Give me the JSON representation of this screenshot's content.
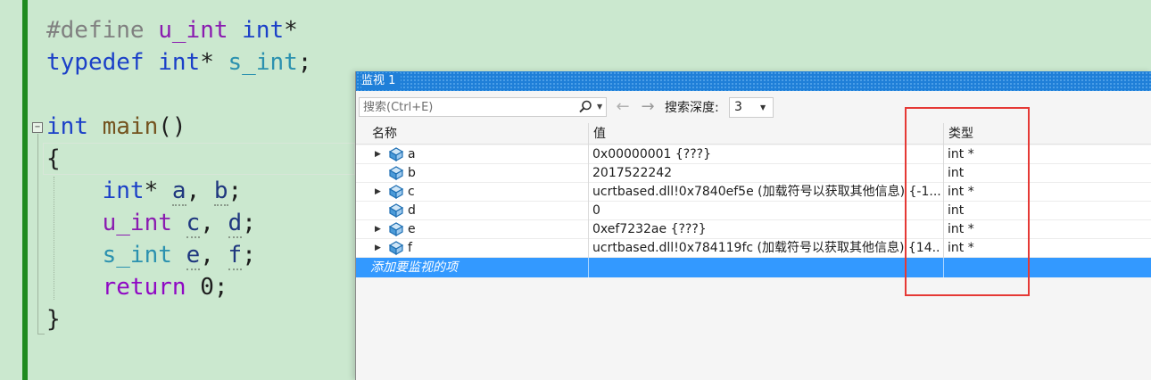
{
  "editor": {
    "lines": [
      {
        "id": "define",
        "parts": [
          {
            "t": "#define ",
            "c": "pre"
          },
          {
            "t": "u_int",
            "c": "macro"
          },
          {
            "t": " ",
            "c": ""
          },
          {
            "t": "int",
            "c": "kw-blue"
          },
          {
            "t": "*",
            "c": ""
          }
        ]
      },
      {
        "id": "typedef",
        "parts": [
          {
            "t": "typedef",
            "c": "kw-blue"
          },
          {
            "t": " ",
            "c": ""
          },
          {
            "t": "int",
            "c": "kw-blue"
          },
          {
            "t": "* ",
            "c": ""
          },
          {
            "t": "s_int",
            "c": "type"
          },
          {
            "t": ";",
            "c": ""
          }
        ]
      },
      {
        "id": "main-sig",
        "parts": [
          {
            "t": "int",
            "c": "kw-blue"
          },
          {
            "t": " ",
            "c": ""
          },
          {
            "t": "main",
            "c": "fn"
          },
          {
            "t": "()",
            "c": ""
          }
        ]
      },
      {
        "id": "brace-open",
        "parts": [
          {
            "t": "{",
            "c": ""
          }
        ]
      },
      {
        "id": "decl-ab",
        "parts": [
          {
            "t": "    ",
            "c": ""
          },
          {
            "t": "int",
            "c": "kw-blue"
          },
          {
            "t": "* ",
            "c": ""
          },
          {
            "t": "a",
            "c": "var dotted"
          },
          {
            "t": ", ",
            "c": ""
          },
          {
            "t": "b",
            "c": "var dotted"
          },
          {
            "t": ";",
            "c": ""
          }
        ]
      },
      {
        "id": "decl-cd",
        "parts": [
          {
            "t": "    ",
            "c": ""
          },
          {
            "t": "u_int",
            "c": "macro"
          },
          {
            "t": " ",
            "c": ""
          },
          {
            "t": "c",
            "c": "var dotted"
          },
          {
            "t": ", ",
            "c": ""
          },
          {
            "t": "d",
            "c": "var dotted"
          },
          {
            "t": ";",
            "c": ""
          }
        ]
      },
      {
        "id": "decl-ef",
        "parts": [
          {
            "t": "    ",
            "c": ""
          },
          {
            "t": "s_int",
            "c": "type"
          },
          {
            "t": " ",
            "c": ""
          },
          {
            "t": "e",
            "c": "var dotted"
          },
          {
            "t": ", ",
            "c": ""
          },
          {
            "t": "f",
            "c": "var dotted"
          },
          {
            "t": ";",
            "c": ""
          }
        ]
      },
      {
        "id": "return",
        "parts": [
          {
            "t": "    ",
            "c": ""
          },
          {
            "t": "return",
            "c": "kw-purple"
          },
          {
            "t": " 0;",
            "c": "num"
          }
        ]
      },
      {
        "id": "brace-close",
        "parts": [
          {
            "t": "}",
            "c": ""
          }
        ]
      }
    ],
    "collapse_glyph": "−"
  },
  "watch": {
    "title": "监视 1",
    "search_placeholder": "搜索(Ctrl+E)",
    "search_dropdown_glyph": "▼",
    "back_glyph": "←",
    "forward_glyph": "→",
    "depth_label": "搜索深度:",
    "depth_value": "3",
    "depth_arrow_glyph": "▼",
    "columns": {
      "name": "名称",
      "value": "值",
      "type": "类型"
    },
    "rows": [
      {
        "expandable": true,
        "name": "a",
        "value": "0x00000001 {???}",
        "type": "int *"
      },
      {
        "expandable": false,
        "name": "b",
        "value": "2017522242",
        "type": "int"
      },
      {
        "expandable": true,
        "name": "c",
        "value": "ucrtbased.dll!0x7840ef5e (加载符号以获取其他信息) {-1...",
        "type": "int *"
      },
      {
        "expandable": false,
        "name": "d",
        "value": "0",
        "type": "int"
      },
      {
        "expandable": true,
        "name": "e",
        "value": "0xef7232ae {???}",
        "type": "int *"
      },
      {
        "expandable": true,
        "name": "f",
        "value": "ucrtbased.dll!0x784119fc (加载符号以获取其他信息) {14...",
        "type": "int *"
      }
    ],
    "expand_glyph": "▶",
    "add_row_text": "添加要监视的项",
    "colors": {
      "titlebar": "#1f7fd8",
      "selection": "#3399ff",
      "highlight": "#e53935",
      "editor_bg": "#cbe8cf"
    }
  }
}
